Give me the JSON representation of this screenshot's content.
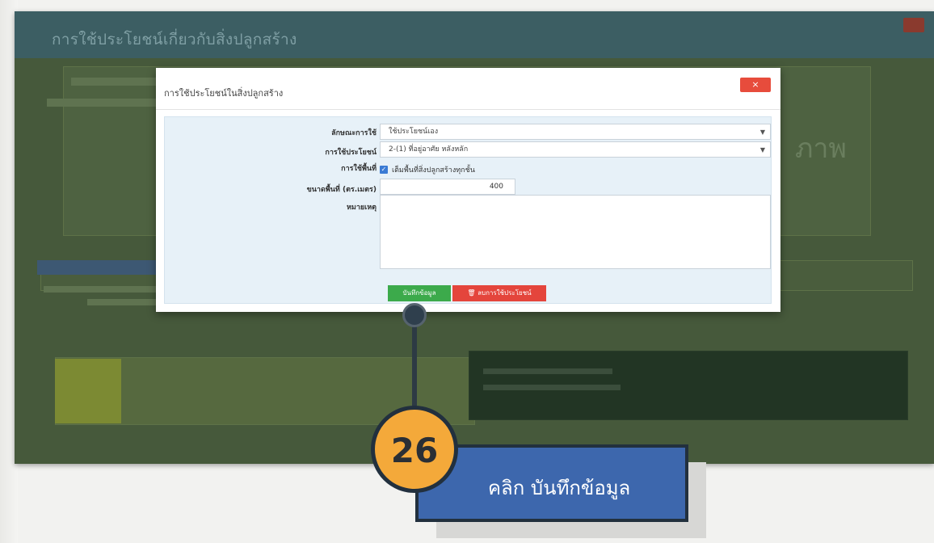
{
  "app": {
    "title": "การใช้ประโยชน์เกี่ยวกับสิ่งปลูกสร้าง",
    "background_partial_text": "ภาพ"
  },
  "modal": {
    "title": "การใช้ประโยชน์ในสิ่งปลูกสร้าง",
    "close_label": "×",
    "fields": {
      "usage_type_label": "ลักษณะการใช้",
      "usage_type_value": "ใช้ประโยชน์เอง",
      "benefit_label": "การใช้ประโยชน์",
      "benefit_value": "2-(1) ที่อยู่อาศัย หลังหลัก",
      "area_usage_label": "การใช้พื้นที่",
      "full_area_checkbox_label": "เต็มพื้นที่สิ่งปลูกสร้างทุกชั้น",
      "full_area_checked": true,
      "area_size_label": "ขนาดพื้นที่ (ตร.เมตร)",
      "area_size_value": "400",
      "note_label": "หมายเหตุ",
      "note_value": ""
    },
    "buttons": {
      "save_label": "บันทึกข้อมูล",
      "delete_label": "ลบการใช้ประโยชน์"
    }
  },
  "callout": {
    "step_number": "26",
    "instruction": "คลิก บันทึกข้อมูล"
  },
  "colors": {
    "save_button": "#3caa4b",
    "delete_button": "#e4453c",
    "close_button": "#e74c3c",
    "callout_box": "#3d67ad",
    "step_badge": "#f4a93a"
  }
}
